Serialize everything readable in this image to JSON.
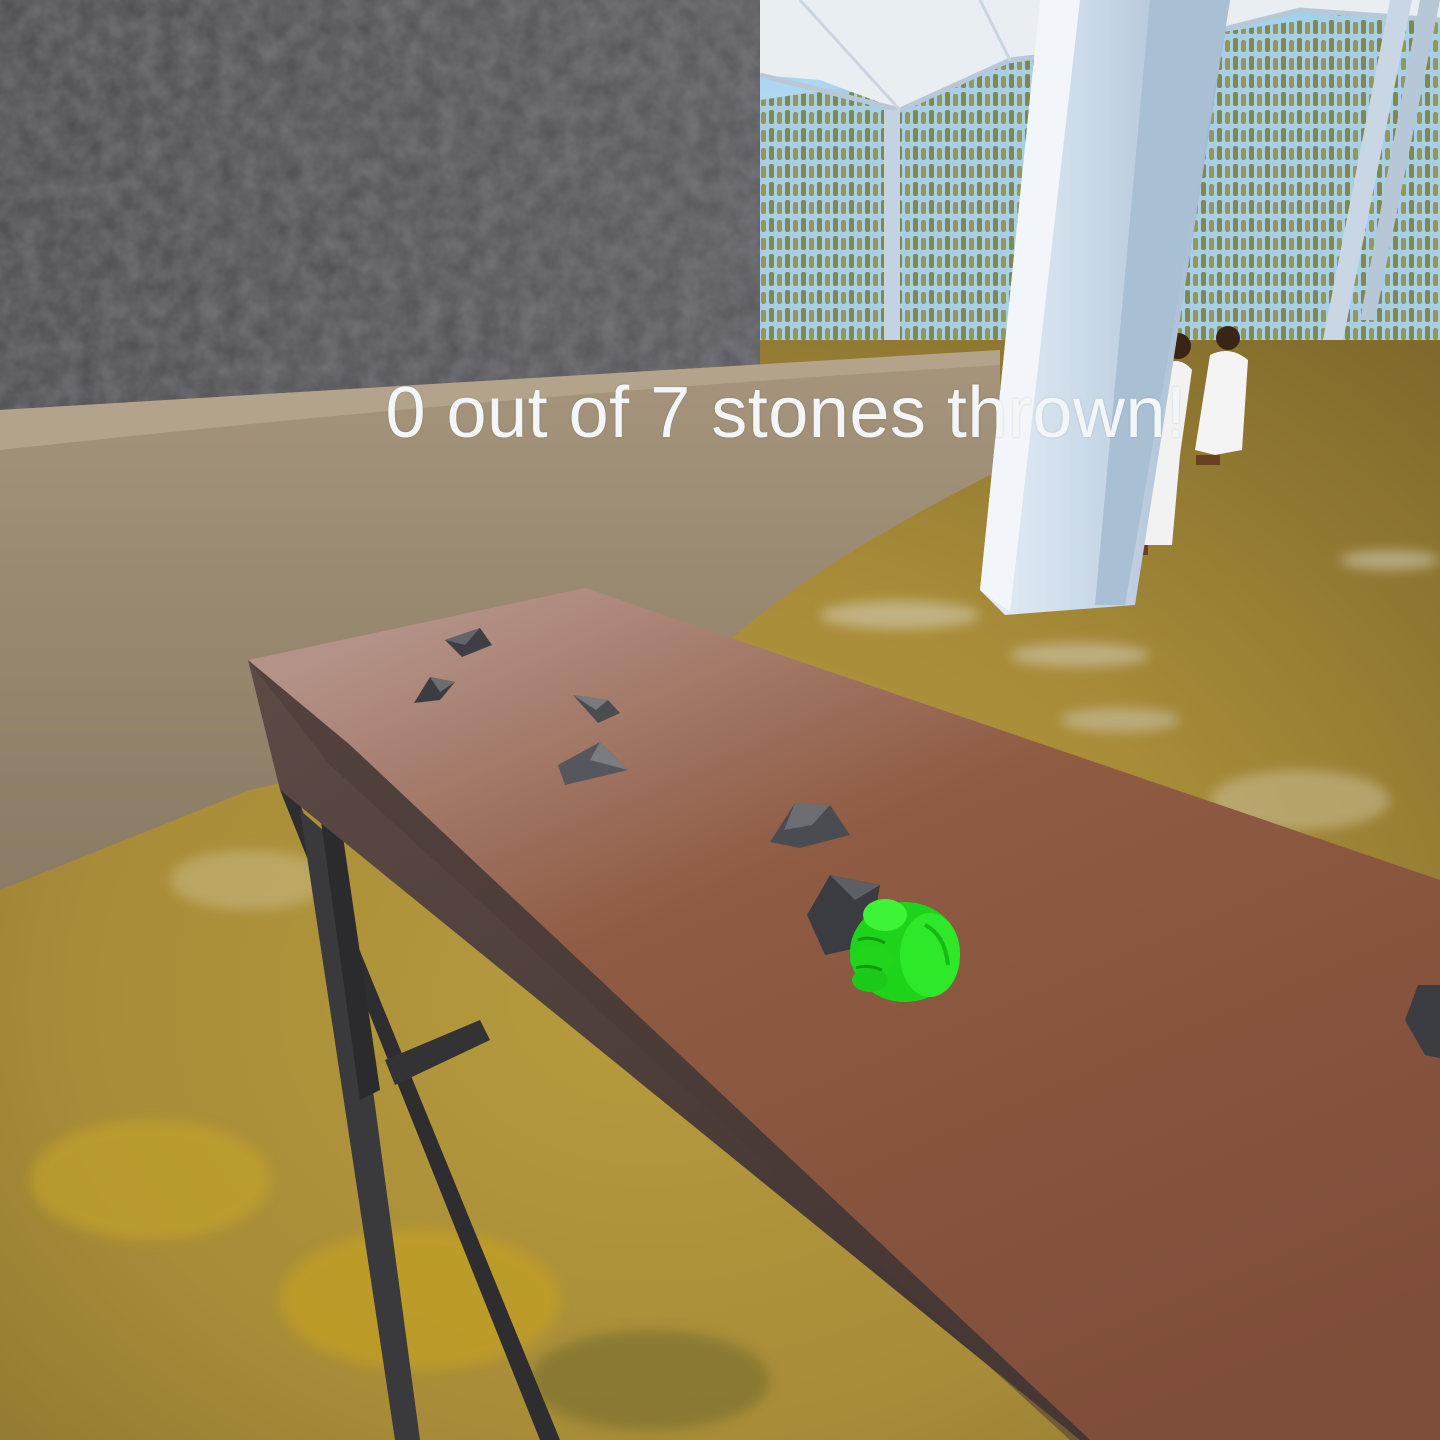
{
  "hud": {
    "stones_thrown": 0,
    "stones_total": 7,
    "status_text": "0 out of 7 stones thrown!"
  },
  "scene": {
    "hand_icon": "green-vr-hand-icon",
    "stone_icon": "stone-icon",
    "colors": {
      "hand": "#22e81c",
      "table_top": "#8f5a45",
      "pillar": "#c9d8e6",
      "ground": "#b89a3a",
      "wall": "#4f4f52"
    }
  }
}
